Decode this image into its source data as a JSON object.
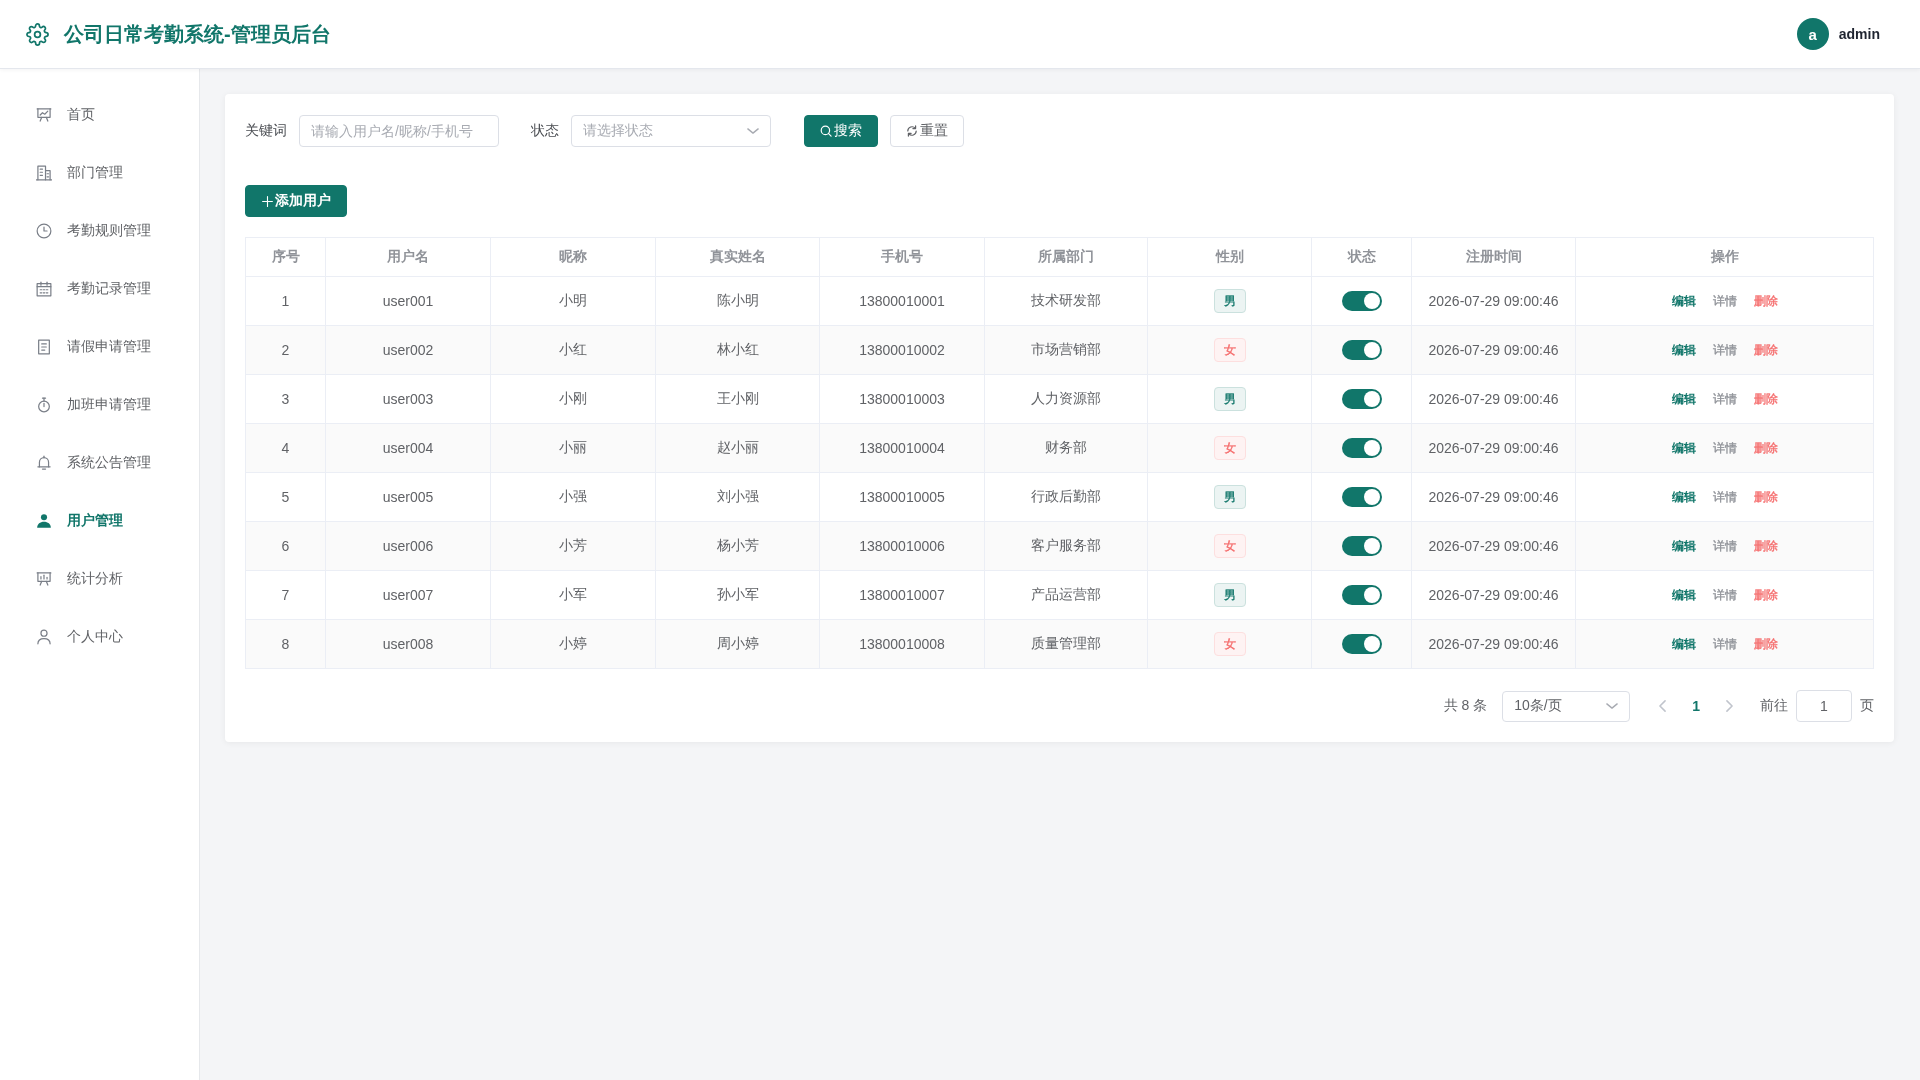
{
  "header": {
    "title": "公司日常考勤系统-管理员后台",
    "user": {
      "avatar": "a",
      "name": "admin"
    }
  },
  "sidebar": {
    "items": [
      {
        "label": "首页",
        "selected": false
      },
      {
        "label": "部门管理",
        "selected": false
      },
      {
        "label": "考勤规则管理",
        "selected": false
      },
      {
        "label": "考勤记录管理",
        "selected": false
      },
      {
        "label": "请假申请管理",
        "selected": false
      },
      {
        "label": "加班申请管理",
        "selected": false
      },
      {
        "label": "系统公告管理",
        "selected": false
      },
      {
        "label": "用户管理",
        "selected": true
      },
      {
        "label": "统计分析",
        "selected": false
      },
      {
        "label": "个人中心",
        "selected": false
      }
    ]
  },
  "filters": {
    "keyword": {
      "label": "关键词",
      "placeholder": "请输入用户名/昵称/手机号"
    },
    "status": {
      "label": "状态",
      "placeholder": "请选择状态"
    },
    "buttons": [
      {
        "label": "搜索",
        "kind": "search"
      },
      {
        "label": "重置",
        "kind": "reset"
      }
    ]
  },
  "add_button": {
    "label": "添加用户"
  },
  "table": {
    "columns": [
      "序号",
      "用户名",
      "昵称",
      "真实姓名",
      "手机号",
      "所属部门",
      "性别",
      "状态",
      "注册时间",
      "操作"
    ],
    "rows": [
      {
        "index": "1",
        "username": "user001",
        "nickname": "小明",
        "real_name": "陈小明",
        "phone": "13800010001",
        "department": "技术研发部",
        "gender": {
          "label": "男",
          "color": "#11766a"
        },
        "enabled": true,
        "registered": "2026-07-29 09:00:46",
        "actions": [
          {
            "label": "编辑",
            "color": "#11766a"
          },
          {
            "label": "详情",
            "color": "#909399"
          },
          {
            "label": "删除",
            "color": "#f56c6c"
          }
        ]
      },
      {
        "index": "2",
        "username": "user002",
        "nickname": "小红",
        "real_name": "林小红",
        "phone": "13800010002",
        "department": "市场营销部",
        "gender": {
          "label": "女",
          "color": "#f56c6c"
        },
        "enabled": true,
        "registered": "2026-07-29 09:00:46",
        "actions": [
          {
            "label": "编辑",
            "color": "#11766a"
          },
          {
            "label": "详情",
            "color": "#909399"
          },
          {
            "label": "删除",
            "color": "#f56c6c"
          }
        ]
      },
      {
        "index": "3",
        "username": "user003",
        "nickname": "小刚",
        "real_name": "王小刚",
        "phone": "13800010003",
        "department": "人力资源部",
        "gender": {
          "label": "男",
          "color": "#11766a"
        },
        "enabled": true,
        "registered": "2026-07-29 09:00:46",
        "actions": [
          {
            "label": "编辑",
            "color": "#11766a"
          },
          {
            "label": "详情",
            "color": "#909399"
          },
          {
            "label": "删除",
            "color": "#f56c6c"
          }
        ]
      },
      {
        "index": "4",
        "username": "user004",
        "nickname": "小丽",
        "real_name": "赵小丽",
        "phone": "13800010004",
        "department": "财务部",
        "gender": {
          "label": "女",
          "color": "#f56c6c"
        },
        "enabled": true,
        "registered": "2026-07-29 09:00:46",
        "actions": [
          {
            "label": "编辑",
            "color": "#11766a"
          },
          {
            "label": "详情",
            "color": "#909399"
          },
          {
            "label": "删除",
            "color": "#f56c6c"
          }
        ]
      },
      {
        "index": "5",
        "username": "user005",
        "nickname": "小强",
        "real_name": "刘小强",
        "phone": "13800010005",
        "department": "行政后勤部",
        "gender": {
          "label": "男",
          "color": "#11766a"
        },
        "enabled": true,
        "registered": "2026-07-29 09:00:46",
        "actions": [
          {
            "label": "编辑",
            "color": "#11766a"
          },
          {
            "label": "详情",
            "color": "#909399"
          },
          {
            "label": "删除",
            "color": "#f56c6c"
          }
        ]
      },
      {
        "index": "6",
        "username": "user006",
        "nickname": "小芳",
        "real_name": "杨小芳",
        "phone": "13800010006",
        "department": "客户服务部",
        "gender": {
          "label": "女",
          "color": "#f56c6c"
        },
        "enabled": true,
        "registered": "2026-07-29 09:00:46",
        "actions": [
          {
            "label": "编辑",
            "color": "#11766a"
          },
          {
            "label": "详情",
            "color": "#909399"
          },
          {
            "label": "删除",
            "color": "#f56c6c"
          }
        ]
      },
      {
        "index": "7",
        "username": "user007",
        "nickname": "小军",
        "real_name": "孙小军",
        "phone": "13800010007",
        "department": "产品运营部",
        "gender": {
          "label": "男",
          "color": "#11766a"
        },
        "enabled": true,
        "registered": "2026-07-29 09:00:46",
        "actions": [
          {
            "label": "编辑",
            "color": "#11766a"
          },
          {
            "label": "详情",
            "color": "#909399"
          },
          {
            "label": "删除",
            "color": "#f56c6c"
          }
        ]
      },
      {
        "index": "8",
        "username": "user008",
        "nickname": "小婷",
        "real_name": "周小婷",
        "phone": "13800010008",
        "department": "质量管理部",
        "gender": {
          "label": "女",
          "color": "#f56c6c"
        },
        "enabled": true,
        "registered": "2026-07-29 09:00:46",
        "actions": [
          {
            "label": "编辑",
            "color": "#11766a"
          },
          {
            "label": "详情",
            "color": "#909399"
          },
          {
            "label": "删除",
            "color": "#f56c6c"
          }
        ]
      }
    ]
  },
  "pagination": {
    "total": "共 8 条",
    "page_size": "10条/页",
    "prev_disabled": true,
    "pages": [
      {
        "label": "1",
        "selected": true
      }
    ],
    "next_disabled": true,
    "goto_label": "前往",
    "goto_value": "1",
    "goto_suffix": "页"
  }
}
